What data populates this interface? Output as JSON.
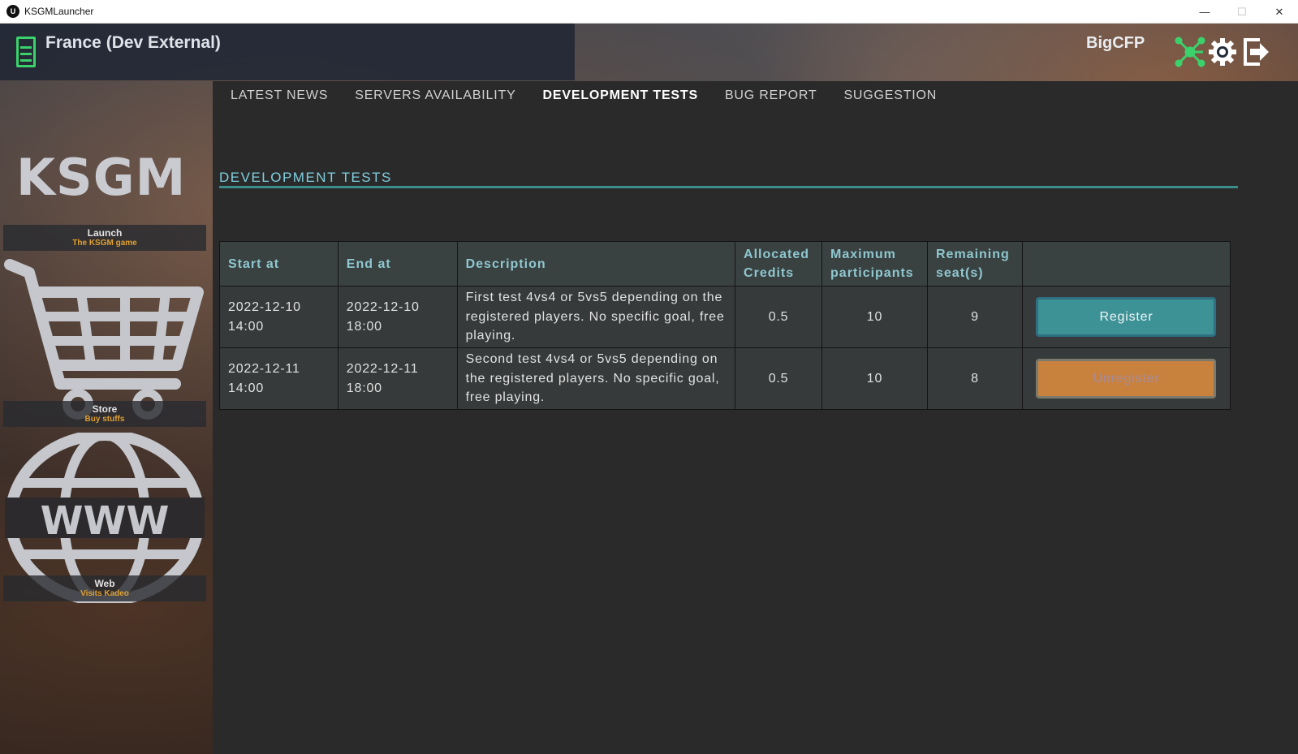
{
  "window": {
    "title": "KSGMLauncher",
    "app_icon_glyph": "U"
  },
  "header": {
    "server_name": "France (Dev External)",
    "username": "BigCFP",
    "icons": [
      "menu-icon",
      "network-icon",
      "gear-icon",
      "logout-icon"
    ],
    "accent_color": "#3bd16b"
  },
  "sidebar": {
    "logo": "KSGM",
    "items": [
      {
        "title": "Launch",
        "subtitle": "The KSGM game"
      },
      {
        "title": "Store",
        "subtitle": "Buy stuffs"
      },
      {
        "title": "Web",
        "subtitle": "Visits Kadeo"
      }
    ],
    "web_icon_text": "WWW"
  },
  "tabs": [
    {
      "label": "LATEST NEWS",
      "active": false
    },
    {
      "label": "SERVERS AVAILABILITY",
      "active": false
    },
    {
      "label": "DEVELOPMENT TESTS",
      "active": true
    },
    {
      "label": "BUG REPORT",
      "active": false
    },
    {
      "label": "SUGGESTION",
      "active": false
    }
  ],
  "section": {
    "title": "DEVELOPMENT TESTS"
  },
  "table": {
    "headers": [
      "Start at",
      "End at",
      "Description",
      "Allocated Credits",
      "Maximum participants",
      "Remaining seat(s)",
      ""
    ],
    "rows": [
      {
        "start": "2022-12-10 14:00",
        "end": "2022-12-10 18:00",
        "description": "First test 4vs4 or 5vs5 depending on the registered players. No specific goal, free playing.",
        "credits": "0.5",
        "max_participants": "10",
        "remaining": "9",
        "action": "Register"
      },
      {
        "start": "2022-12-11 14:00",
        "end": "2022-12-11 18:00",
        "description": "Second test 4vs4 or 5vs5 depending on the registered players. No specific goal, free playing.",
        "credits": "0.5",
        "max_participants": "10",
        "remaining": "8",
        "action": "Unregister"
      }
    ]
  },
  "colors": {
    "register": "#3d9296",
    "unregister": "#c8823e",
    "section_title": "#7fd0e0"
  }
}
